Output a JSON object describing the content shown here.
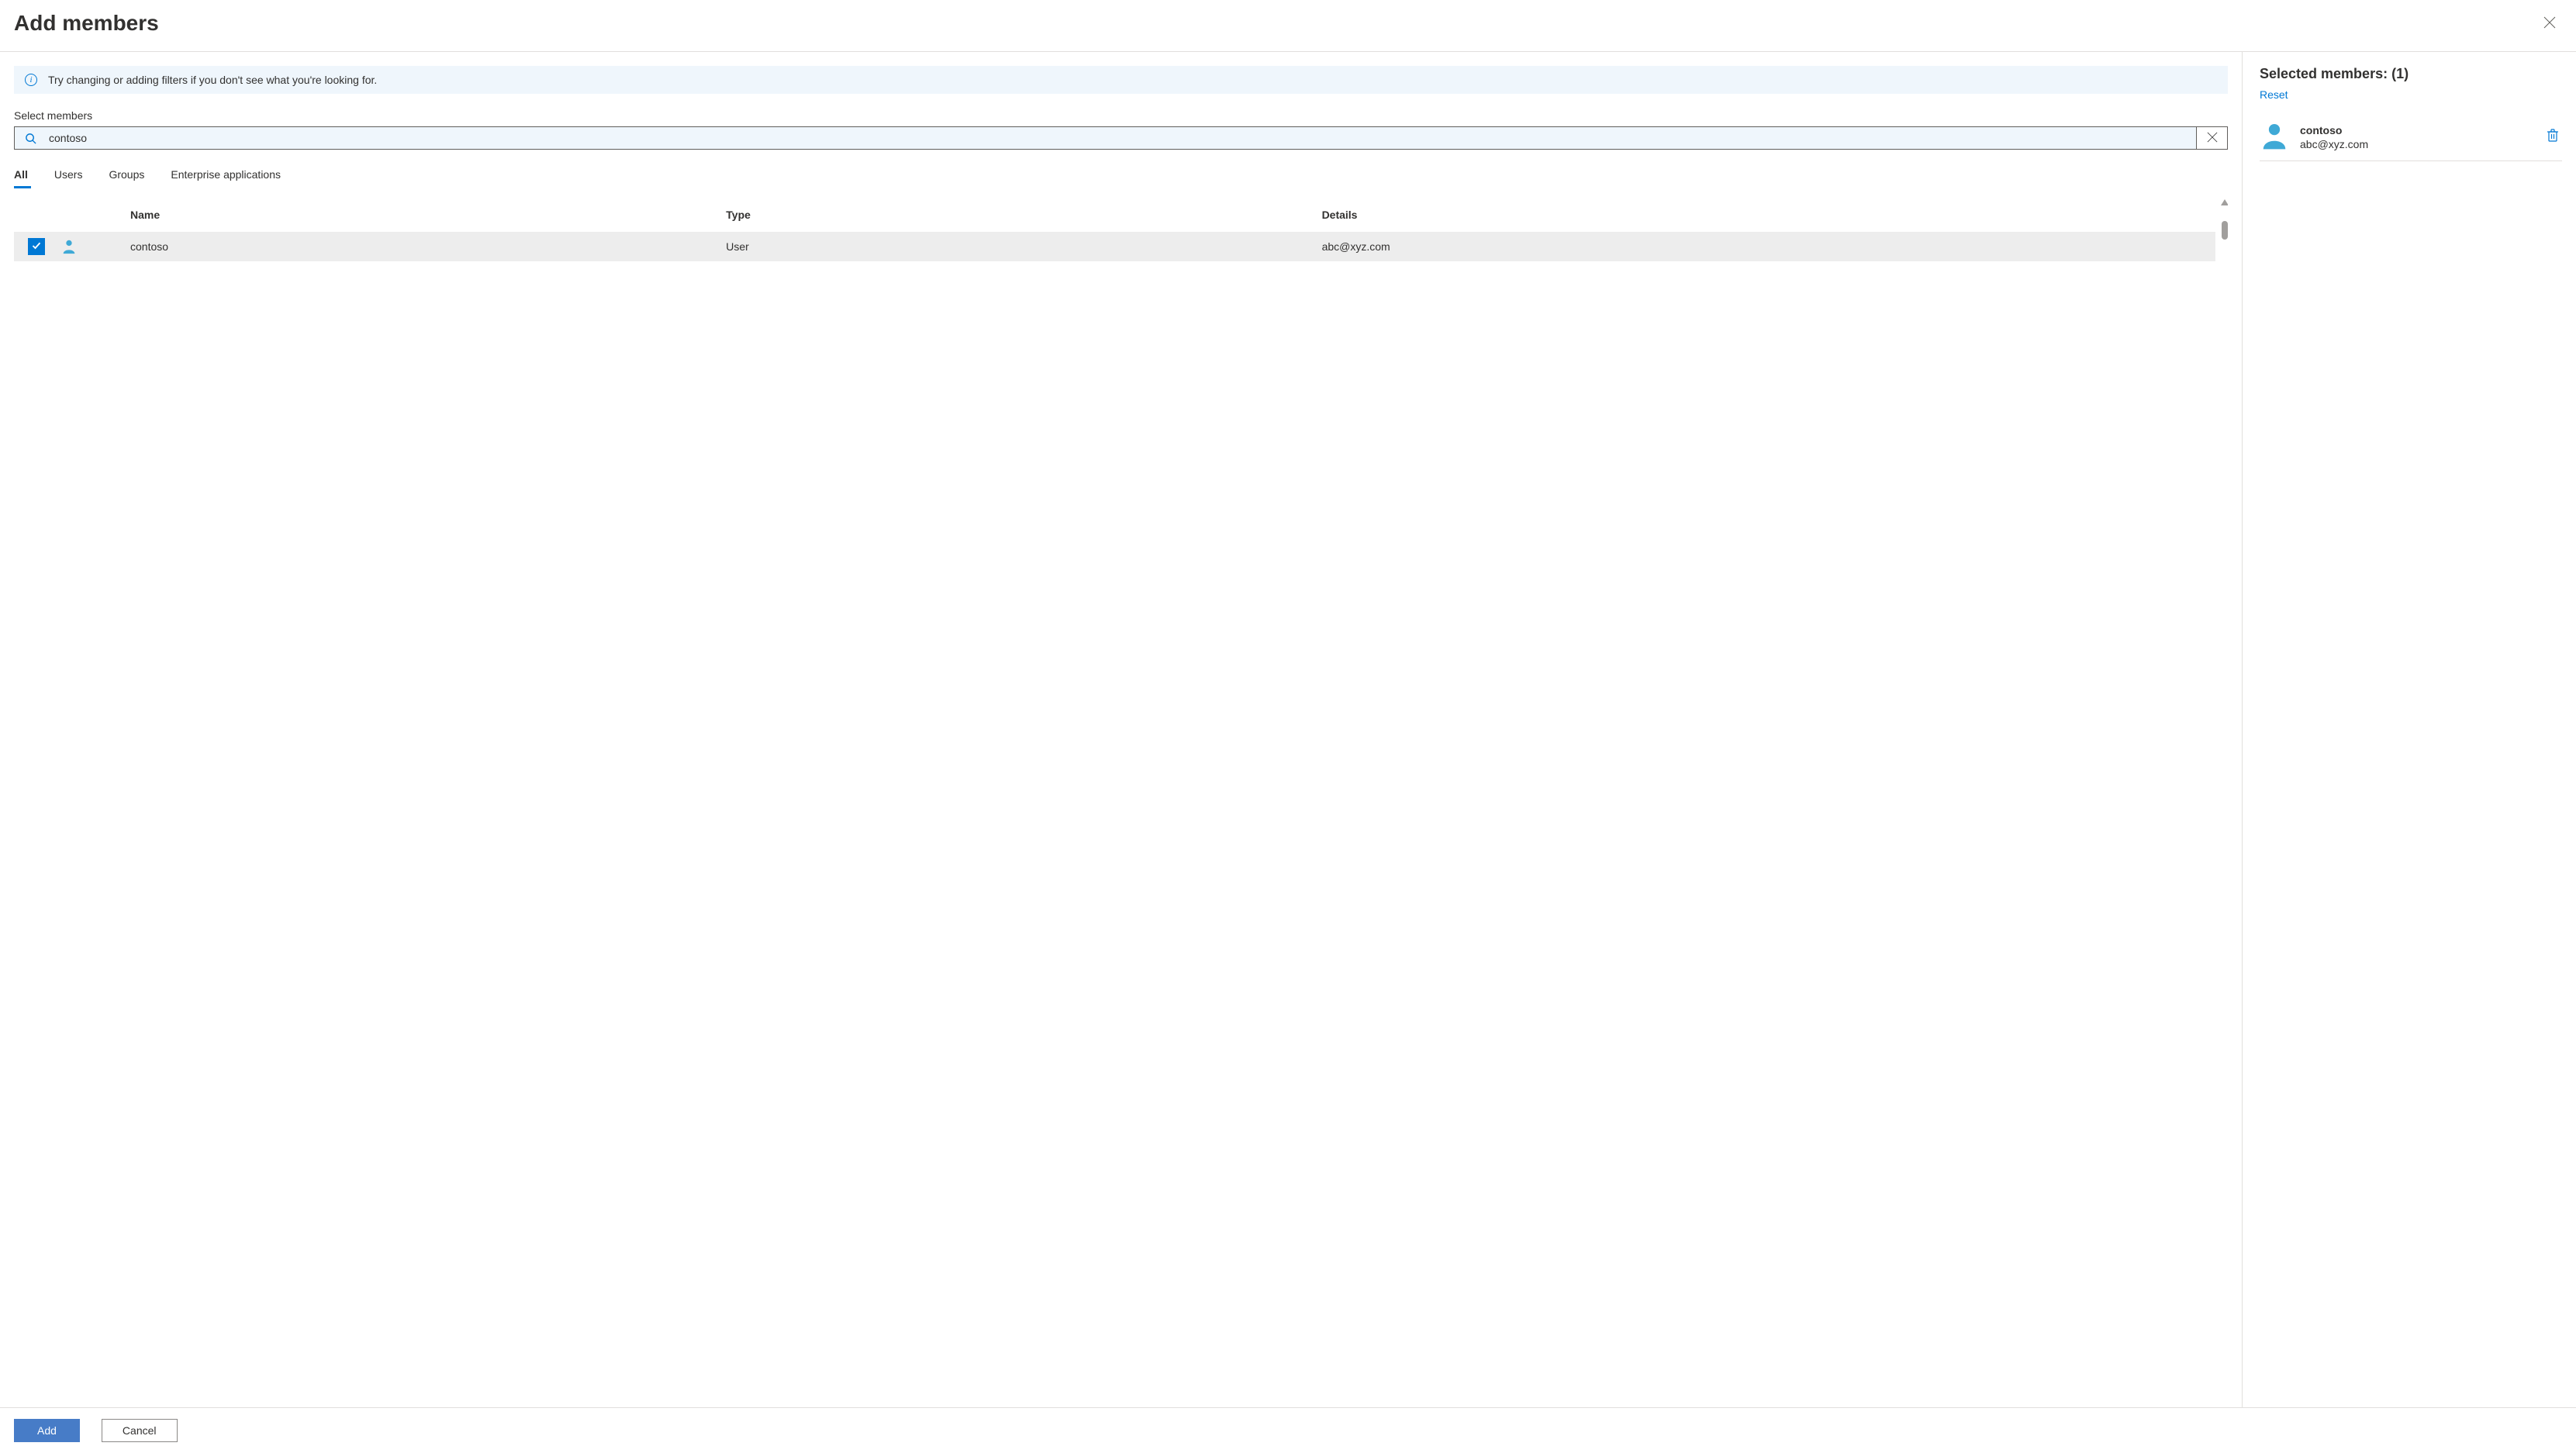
{
  "header": {
    "title": "Add members"
  },
  "info_banner": {
    "text": "Try changing or adding filters if you don't see what you're looking for."
  },
  "search": {
    "label": "Select members",
    "value": "contoso"
  },
  "tabs": {
    "items": [
      {
        "label": "All",
        "active": true
      },
      {
        "label": "Users",
        "active": false
      },
      {
        "label": "Groups",
        "active": false
      },
      {
        "label": "Enterprise applications",
        "active": false
      }
    ]
  },
  "columns": {
    "name": "Name",
    "type": "Type",
    "details": "Details"
  },
  "results": [
    {
      "checked": true,
      "name": "contoso",
      "type": "User",
      "details": "abc@xyz.com"
    }
  ],
  "selected": {
    "title_prefix": "Selected members: ",
    "count_display": "(1)",
    "reset_label": "Reset",
    "items": [
      {
        "name": "contoso",
        "detail": "abc@xyz.com"
      }
    ]
  },
  "footer": {
    "add": "Add",
    "cancel": "Cancel"
  }
}
